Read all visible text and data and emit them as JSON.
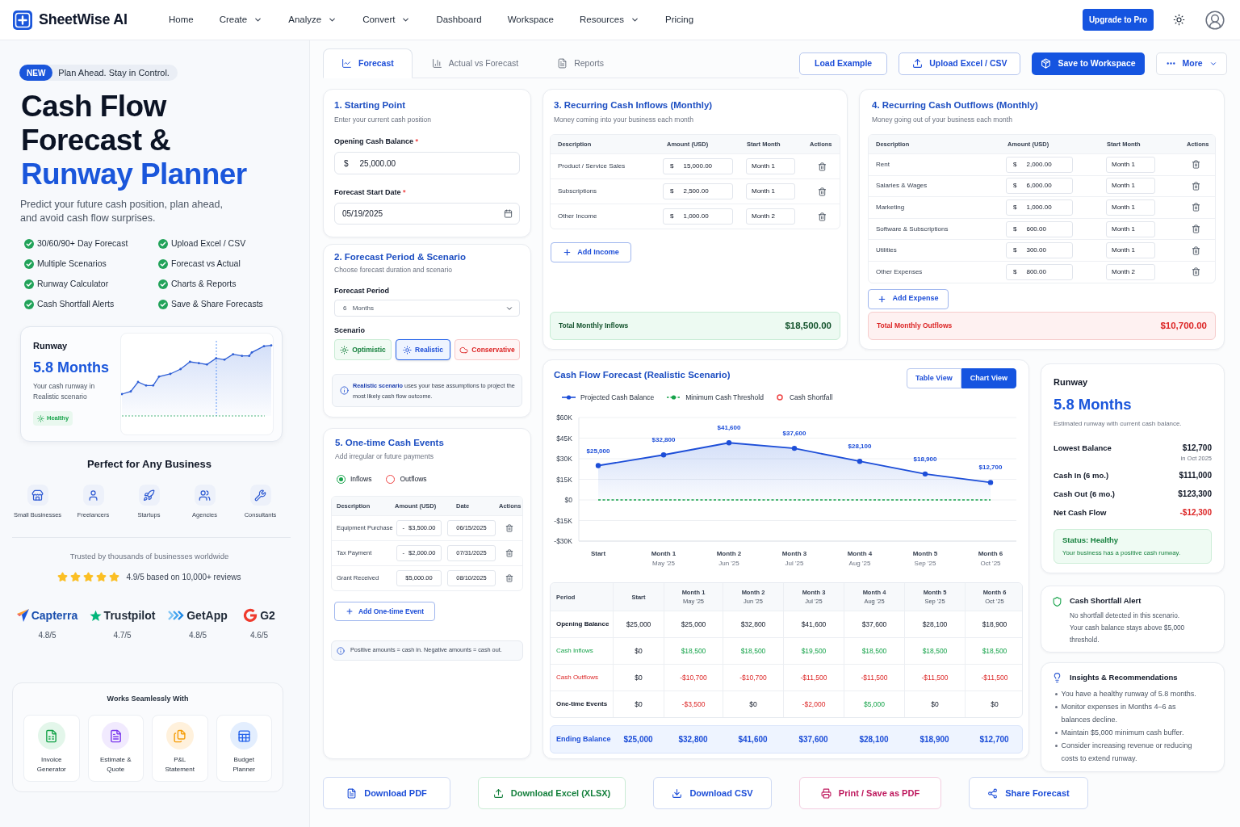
{
  "navbar": {
    "logo": "SheetWise AI",
    "links": [
      {
        "label": "Home",
        "dropdown": false
      },
      {
        "label": "Create",
        "dropdown": true
      },
      {
        "label": "Analyze",
        "dropdown": true
      },
      {
        "label": "Convert",
        "dropdown": true
      },
      {
        "label": "Dashboard",
        "dropdown": false
      },
      {
        "label": "Workspace",
        "dropdown": false
      },
      {
        "label": "Resources",
        "dropdown": true
      },
      {
        "label": "Pricing",
        "dropdown": false
      }
    ],
    "upgrade_button": "Upgrade to Pro"
  },
  "hero": {
    "badge": "NEW",
    "tagline": "Plan Ahead. Stay in Control.",
    "title_lines": [
      {
        "text": "Cash Flow",
        "accent": false
      },
      {
        "text": "Forecast &",
        "accent": false
      },
      {
        "text": "Runway Planner",
        "accent": true
      }
    ],
    "subtitle": "Predict your future cash position, plan ahead, and avoid cash flow surprises.",
    "features": [
      "30/60/90+ Day Forecast",
      "Upload Excel / CSV",
      "Multiple Scenarios",
      "Forecast vs Actual",
      "Runway Calculator",
      "Charts & Reports",
      "Cash Shortfall Alerts",
      "Save & Share Forecasts"
    ],
    "runway_card": {
      "label": "Runway",
      "value": "5.8 Months",
      "caption": "Your cash runway in Realistic scenario",
      "status": "Healthy"
    }
  },
  "audiences": {
    "title": "Perfect for Any Business",
    "items": [
      "Small Businesses",
      "Freelancers",
      "Startups",
      "Agencies",
      "Consultants"
    ]
  },
  "trust": {
    "text": "Trusted by thousands of businesses worldwide",
    "stars": 5,
    "rating": "4.9/5 based on 10,000+ reviews",
    "platforms": [
      {
        "name": "Capterra",
        "rating": "4.8/5"
      },
      {
        "name": "Trustpilot",
        "rating": "4.7/5"
      },
      {
        "name": "GetApp",
        "rating": "4.8/5"
      },
      {
        "name": "G2",
        "rating": "4.6/5"
      }
    ]
  },
  "integrations": {
    "title": "Works Seamlessly With",
    "items": [
      "Invoice Generator",
      "Estimate & Quote",
      "P&L Statement",
      "Budget Planner"
    ]
  },
  "toolbar": {
    "tabs": [
      {
        "label": "Forecast",
        "selected": true
      },
      {
        "label": "Actual vs Forecast",
        "selected": false
      },
      {
        "label": "Reports",
        "selected": false
      }
    ],
    "buttons": [
      {
        "label": "Load Example",
        "kind": "outline"
      },
      {
        "label": "Upload Excel / CSV",
        "kind": "upload"
      },
      {
        "label": "Save to Workspace",
        "kind": "primary"
      },
      {
        "label": "More",
        "kind": "menu"
      }
    ]
  },
  "starting_point": {
    "title": "1. Starting Point",
    "subtitle": "Enter your current cash position",
    "opening_balance": {
      "label": "Opening Cash Balance",
      "required_mark": "*",
      "prefix": "$",
      "value": "25,000.00"
    },
    "start_date": {
      "label": "Forecast Start Date",
      "required_mark": "*",
      "value": "05/19/2025"
    }
  },
  "period_scenario": {
    "title": "2. Forecast Period & Scenario",
    "subtitle": "Choose forecast duration and scenario",
    "period_label": "Forecast Period",
    "period_value": "6 Months",
    "scenario_label": "Scenario",
    "scenarios": [
      {
        "label": "Optimistic",
        "kind": "optimistic",
        "selected": false
      },
      {
        "label": "Realistic",
        "kind": "realistic",
        "selected": true
      },
      {
        "label": "Conservative",
        "kind": "conservative",
        "selected": false
      }
    ],
    "info": "**Realistic scenario** uses your base assumptions to project the most likely cash flow outcome."
  },
  "inflows": {
    "title": "3. Recurring Cash Inflows (Monthly)",
    "subtitle": "Money coming into your business each month",
    "columns": [
      "Description",
      "Amount (USD)",
      "Start Month",
      "Actions"
    ],
    "rows": [
      {
        "description": "Product / Service Sales",
        "prefix": "$",
        "amount": "15,000.00",
        "start_month": "Month 1"
      },
      {
        "description": "Subscriptions",
        "prefix": "$",
        "amount": "2,500.00",
        "start_month": "Month 1"
      },
      {
        "description": "Other Income",
        "prefix": "$",
        "amount": "1,000.00",
        "start_month": "Month 2"
      }
    ],
    "add_button": "Add Income",
    "total_label": "Total Monthly Inflows",
    "total_value": "$18,500.00"
  },
  "outflows": {
    "title": "4. Recurring Cash Outflows (Monthly)",
    "subtitle": "Money going out of your business each month",
    "columns": [
      "Description",
      "Amount (USD)",
      "Start Month",
      "Actions"
    ],
    "rows": [
      {
        "description": "Rent",
        "prefix": "$",
        "amount": "2,000.00",
        "start_month": "Month 1"
      },
      {
        "description": "Salaries & Wages",
        "prefix": "$",
        "amount": "6,000.00",
        "start_month": "Month 1"
      },
      {
        "description": "Marketing",
        "prefix": "$",
        "amount": "1,000.00",
        "start_month": "Month 1"
      },
      {
        "description": "Software & Subscriptions",
        "prefix": "$",
        "amount": "600.00",
        "start_month": "Month 1"
      },
      {
        "description": "Utilities",
        "prefix": "$",
        "amount": "300.00",
        "start_month": "Month 1"
      },
      {
        "description": "Other Expenses",
        "prefix": "$",
        "amount": "800.00",
        "start_month": "Month 2"
      }
    ],
    "add_button": "Add Expense",
    "total_label": "Total Monthly Outflows",
    "total_value": "$10,700.00"
  },
  "one_time_events": {
    "title": "5. One-time Cash Events",
    "subtitle": "Add irregular or future payments",
    "types": [
      {
        "label": "Inflows",
        "kind": "inflow",
        "selected": true
      },
      {
        "label": "Outflows",
        "kind": "outflow",
        "selected": false
      }
    ],
    "columns": [
      "Description",
      "Amount (USD)",
      "Date",
      "Actions"
    ],
    "rows": [
      {
        "description": "Equipment Purchase",
        "sign": "-",
        "amount": "$3,500.00",
        "date": "06/15/2025"
      },
      {
        "description": "Tax Payment",
        "sign": "-",
        "amount": "$2,000.00",
        "date": "07/31/2025"
      },
      {
        "description": "Grant Received",
        "amount": "$5,000.00",
        "date": "08/10/2025"
      }
    ],
    "add_button": "Add One-time Event",
    "note": "Positive amounts = cash in. Negative amounts = cash out."
  },
  "forecast": {
    "title": "Cash Flow Forecast (Realistic Scenario)",
    "views": [
      {
        "label": "Table View",
        "selected": false
      },
      {
        "label": "Chart View",
        "selected": true
      }
    ],
    "shortfall_legend": "Cash Shortfall",
    "chart_month_dates": [
      "May '25",
      "Jun '25",
      "Jul '25",
      "Aug '25",
      "Sep '25",
      "Oct '25"
    ],
    "chart_data": {
      "type": "line",
      "categories": [
        "Start",
        "Month 1",
        "Month 2",
        "Month 3",
        "Month 4",
        "Month 5",
        "Month 6"
      ],
      "series": [
        {
          "name": "Projected Cash Balance",
          "color": "#1d4ed8",
          "line_style": "solid",
          "marker": "circle",
          "values": [
            25000,
            32800,
            41600,
            37600,
            28100,
            18900,
            12700
          ]
        },
        {
          "name": "Minimum Cash Threshold",
          "color": "#16a34a",
          "line_style": "dashed",
          "marker": "none",
          "values": [
            0,
            0,
            0,
            0,
            0,
            0,
            0
          ]
        }
      ],
      "ylim": [
        -30000,
        60000
      ],
      "yticks": [
        {
          "value": 60000,
          "label": "$60K"
        },
        {
          "value": 45000,
          "label": "$45K"
        },
        {
          "value": 30000,
          "label": "$30K"
        },
        {
          "value": 15000,
          "label": "$15K"
        },
        {
          "value": 0,
          "label": "$0"
        },
        {
          "value": -15000,
          "label": "-$15K"
        },
        {
          "value": -30000,
          "label": "-$30K"
        }
      ],
      "grid": true,
      "value_labels": [
        "$25,000",
        "$32,800",
        "$41,600",
        "$37,600",
        "$28,100",
        "$18,900",
        "$12,700"
      ]
    },
    "table": {
      "columns": [
        {
          "label": "Period"
        },
        {
          "label": "Start"
        },
        {
          "label": "Month 1",
          "date": "May '25"
        },
        {
          "label": "Month 2",
          "date": "Jun '25"
        },
        {
          "label": "Month 3",
          "date": "Jul '25"
        },
        {
          "label": "Month 4",
          "date": "Aug '25"
        },
        {
          "label": "Month 5",
          "date": "Sep '25"
        },
        {
          "label": "Month 6",
          "date": "Oct '25"
        }
      ],
      "rows": [
        {
          "kind": "balance",
          "cells": [
            {
              "text": "Opening Balance",
              "kind": "label"
            },
            {
              "text": "$25,000",
              "kind": "neutral"
            },
            {
              "text": "$25,000",
              "kind": "neutral"
            },
            {
              "text": "$32,800",
              "kind": "neutral"
            },
            {
              "text": "$41,600",
              "kind": "neutral"
            },
            {
              "text": "$37,600",
              "kind": "neutral"
            },
            {
              "text": "$28,100",
              "kind": "neutral"
            },
            {
              "text": "$18,900",
              "kind": "neutral"
            }
          ]
        },
        {
          "kind": "inflow",
          "cells": [
            {
              "text": "Cash Inflows",
              "kind": "label"
            },
            {
              "text": "$0",
              "kind": "neutral"
            },
            {
              "text": "$18,500",
              "kind": "positive"
            },
            {
              "text": "$18,500",
              "kind": "positive"
            },
            {
              "text": "$19,500",
              "kind": "positive"
            },
            {
              "text": "$18,500",
              "kind": "positive"
            },
            {
              "text": "$18,500",
              "kind": "positive"
            },
            {
              "text": "$18,500",
              "kind": "positive"
            }
          ]
        },
        {
          "kind": "outflow",
          "cells": [
            {
              "text": "Cash Outflows",
              "kind": "label"
            },
            {
              "text": "$0",
              "kind": "neutral"
            },
            {
              "text": "-$10,700",
              "kind": "negative"
            },
            {
              "text": "-$10,700",
              "kind": "negative"
            },
            {
              "text": "-$11,500",
              "kind": "negative"
            },
            {
              "text": "-$11,500",
              "kind": "negative"
            },
            {
              "text": "-$11,500",
              "kind": "negative"
            },
            {
              "text": "-$11,500",
              "kind": "negative"
            }
          ]
        },
        {
          "kind": "events",
          "cells": [
            {
              "text": "One-time Events",
              "kind": "label"
            },
            {
              "text": "$0",
              "kind": "neutral"
            },
            {
              "text": "-$3,500",
              "kind": "negative"
            },
            {
              "text": "$0",
              "kind": "neutral"
            },
            {
              "text": "-$2,000",
              "kind": "negative"
            },
            {
              "text": "$5,000",
              "kind": "positive"
            },
            {
              "text": "$0",
              "kind": "neutral"
            },
            {
              "text": "$0",
              "kind": "neutral"
            }
          ]
        },
        {
          "kind": "ending",
          "cells": [
            {
              "text": "Ending Balance",
              "kind": "label"
            },
            {
              "text": "$25,000",
              "kind": "total"
            },
            {
              "text": "$32,800",
              "kind": "total"
            },
            {
              "text": "$41,600",
              "kind": "total"
            },
            {
              "text": "$37,600",
              "kind": "total"
            },
            {
              "text": "$28,100",
              "kind": "total"
            },
            {
              "text": "$18,900",
              "kind": "total"
            },
            {
              "text": "$12,700",
              "kind": "total"
            }
          ]
        }
      ]
    }
  },
  "runway_summary": {
    "label": "Runway",
    "value": "5.8 Months",
    "caption": "Estimated runway with current cash balance.",
    "metrics": [
      {
        "label": "Lowest Balance",
        "value": "$12,700",
        "note": "in Oct 2025",
        "kind": "neutral"
      },
      {
        "label": "Cash In (6 mo.)",
        "value": "$111,000",
        "kind": "neutral"
      },
      {
        "label": "Cash Out (6 mo.)",
        "value": "$123,300",
        "kind": "neutral"
      },
      {
        "label": "Net Cash Flow",
        "value": "-$12,300",
        "kind": "negative"
      }
    ],
    "status": {
      "title": "Status: Healthy",
      "text": "Your business has a positive cash runway."
    }
  },
  "shortfall_alert": {
    "title": "Cash Shortfall Alert",
    "messages": [
      "No shortfall detected in this scenario.",
      "Your cash balance stays above $5,000 threshold."
    ]
  },
  "insights": {
    "title": "Insights & Recommendations",
    "items": [
      "You have a healthy runway of 5.8 months.",
      "Monitor expenses in Months 4–6 as balances decline.",
      "Maintain $5,000 minimum cash buffer.",
      "Consider increasing revenue or reducing costs to extend runway."
    ]
  },
  "exports": [
    {
      "label": "Download PDF",
      "kind": "pdf"
    },
    {
      "label": "Download Excel (XLSX)",
      "kind": "excel"
    },
    {
      "label": "Download CSV",
      "kind": "csv"
    },
    {
      "label": "Print / Save as PDF",
      "kind": "print"
    },
    {
      "label": "Share Forecast",
      "kind": "share"
    }
  ]
}
